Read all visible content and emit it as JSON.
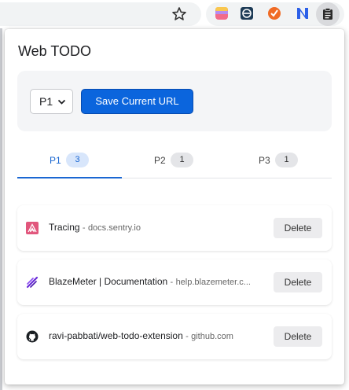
{
  "browser": {
    "extensions": [
      "theme-extension-icon",
      "vpn-extension-icon",
      "tracking-extension-icon",
      "notes-extension-icon",
      "web-todo-extension-icon"
    ]
  },
  "popup": {
    "title": "Web TODO",
    "priority_select": {
      "value": "P1"
    },
    "save_button_label": "Save Current URL",
    "tabs": [
      {
        "label": "P1",
        "count": "3",
        "active": true
      },
      {
        "label": "P2",
        "count": "1",
        "active": false
      },
      {
        "label": "P3",
        "count": "1",
        "active": false
      }
    ],
    "items": [
      {
        "title": "Tracing",
        "separator": "-",
        "domain": "docs.sentry.io",
        "delete_label": "Delete",
        "icon": "sentry-icon"
      },
      {
        "title": "BlazeMeter | Documentation",
        "separator": "-",
        "domain": "help.blazemeter.c...",
        "delete_label": "Delete",
        "icon": "blazemeter-icon"
      },
      {
        "title": "ravi-pabbati/web-todo-extension",
        "separator": "-",
        "domain": "github.com",
        "delete_label": "Delete",
        "icon": "github-icon"
      }
    ]
  },
  "colors": {
    "accent": "#0b65dd",
    "tab_active": "#1a67d2"
  }
}
